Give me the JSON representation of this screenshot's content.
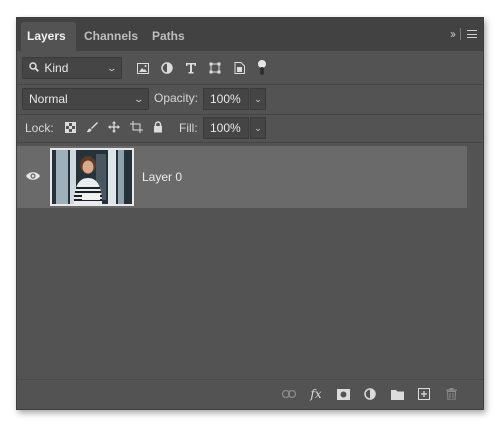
{
  "tabs": [
    {
      "label": "Layers",
      "active": true
    },
    {
      "label": "Channels",
      "active": false
    },
    {
      "label": "Paths",
      "active": false
    }
  ],
  "header": {
    "collapse_icon": "double-chevron-right-icon",
    "menu_icon": "panel-menu-icon"
  },
  "filter": {
    "kind_label": "Kind",
    "icons": [
      "pixel-layer-filter-icon",
      "adjustment-filter-icon",
      "type-filter-icon",
      "shape-filter-icon",
      "smart-object-filter-icon",
      "filter-toggle-icon"
    ]
  },
  "blend": {
    "mode": "Normal",
    "opacity_label": "Opacity:",
    "opacity_value": "100%"
  },
  "lock": {
    "label": "Lock:",
    "icons": [
      "lock-transparent-pixels-icon",
      "lock-image-pixels-icon",
      "lock-position-icon",
      "lock-artboard-icon",
      "lock-all-icon"
    ],
    "fill_label": "Fill:",
    "fill_value": "100%"
  },
  "layers": [
    {
      "name": "Layer 0",
      "visible": true,
      "selected": true
    }
  ],
  "bottom_bar": {
    "icons": [
      "link-layers-icon",
      "fx-icon",
      "add-mask-icon",
      "adjustment-layer-icon",
      "new-group-icon",
      "new-layer-icon",
      "delete-layer-icon"
    ]
  },
  "colors": {
    "panel_bg": "#535353",
    "tabbar_bg": "#424242",
    "selected_row": "#6a6a6a",
    "text": "#d6d6d6"
  }
}
